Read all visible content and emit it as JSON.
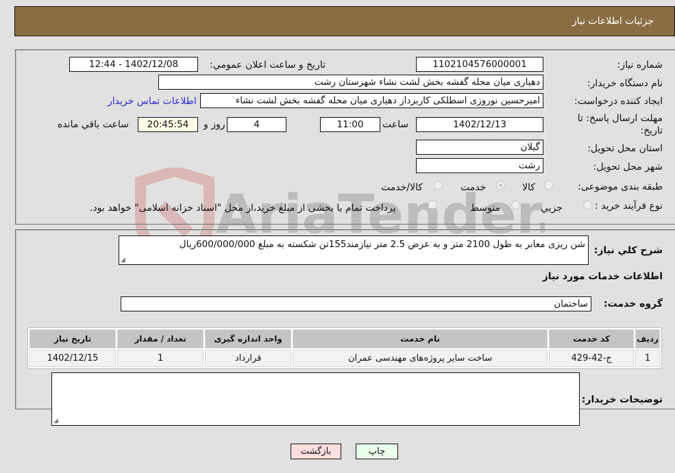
{
  "header": {
    "title": "جزئیات اطلاعات نیاز"
  },
  "details": {
    "need_number_label": "شماره نیاز:",
    "need_number": "1102104576000001",
    "announce_label": "تاريخ و ساعت اعلان عمومي:",
    "announce_value": "1402/12/08 - 12:44",
    "buyer_org_label": "نام دستگاه خریدار:",
    "buyer_org": "دهیاری میان محله گفشه بخش لشت نشاء شهرستان رشت",
    "creator_label": "ایجاد کننده درخواست:",
    "creator": "امیرحسین نوروزی اسطلکی کاربرداز دهیاری میان محله گفشه بخش لشت نشاء",
    "contact_link": "اطلاعات تماس خریدار",
    "deadline_label_line1": "مهلت ارسال پاسخ: تا",
    "deadline_label_line2": "تاریخ:",
    "deadline_date": "1402/12/13",
    "time_label": "ساعت",
    "deadline_time": "11:00",
    "days_value": "4",
    "days_label": "روز و",
    "remaining_time": "20:45:54",
    "remaining_label": "ساعت باقي مانده",
    "province_label": "استان محل تحویل:",
    "province": "گیلان",
    "city_label": "شهر محل تحویل:",
    "city": "رشت",
    "category_label": "طبقه بندی موضوعی:",
    "category_options": [
      "کالا",
      "خدمت",
      "کالا/خدمت"
    ],
    "category_selected": "خدمت",
    "process_label": "نوع فرآیند خرید :",
    "process_options": [
      "جزيي",
      "متوسط"
    ],
    "payment_note": "پرداخت تمام یا بخشی از مبلغ خرید،از محل \"اسناد خزانه اسلامی\" خواهد بود."
  },
  "summary": {
    "label": "شرح كلي نياز:",
    "text": "شن ریزی معابر به طول 2100 متر و به عرض 2.5 متر نیازمند155تن شکسته به مبلغ 600/000/000ریال",
    "services_heading": "اطلاعات خدمات مورد نیاز",
    "service_group_label": "گروه خدمت:",
    "service_group": "ساختمان"
  },
  "table": {
    "headers": [
      "ردیف",
      "کد خدمت",
      "نام خدمت",
      "واحد اندازه گیری",
      "تعداد / مقدار",
      "تاریخ نیاز"
    ],
    "rows": [
      [
        "1",
        "ج-42-429",
        "ساخت سایر پروژه‌های مهندسی عمران",
        "قرارداد",
        "1",
        "1402/12/15"
      ]
    ]
  },
  "buyer_notes": {
    "label": "توضیحات خریدار:",
    "value": ""
  },
  "buttons": {
    "print": "چاپ",
    "back": "بازگشت"
  },
  "watermark": {
    "text": "AriaTender.neT"
  },
  "colors": {
    "header_bg": "#8b6d43",
    "print_bg": "#eaffea",
    "back_bg": "#ffdede",
    "link": "#2a2ad0"
  }
}
